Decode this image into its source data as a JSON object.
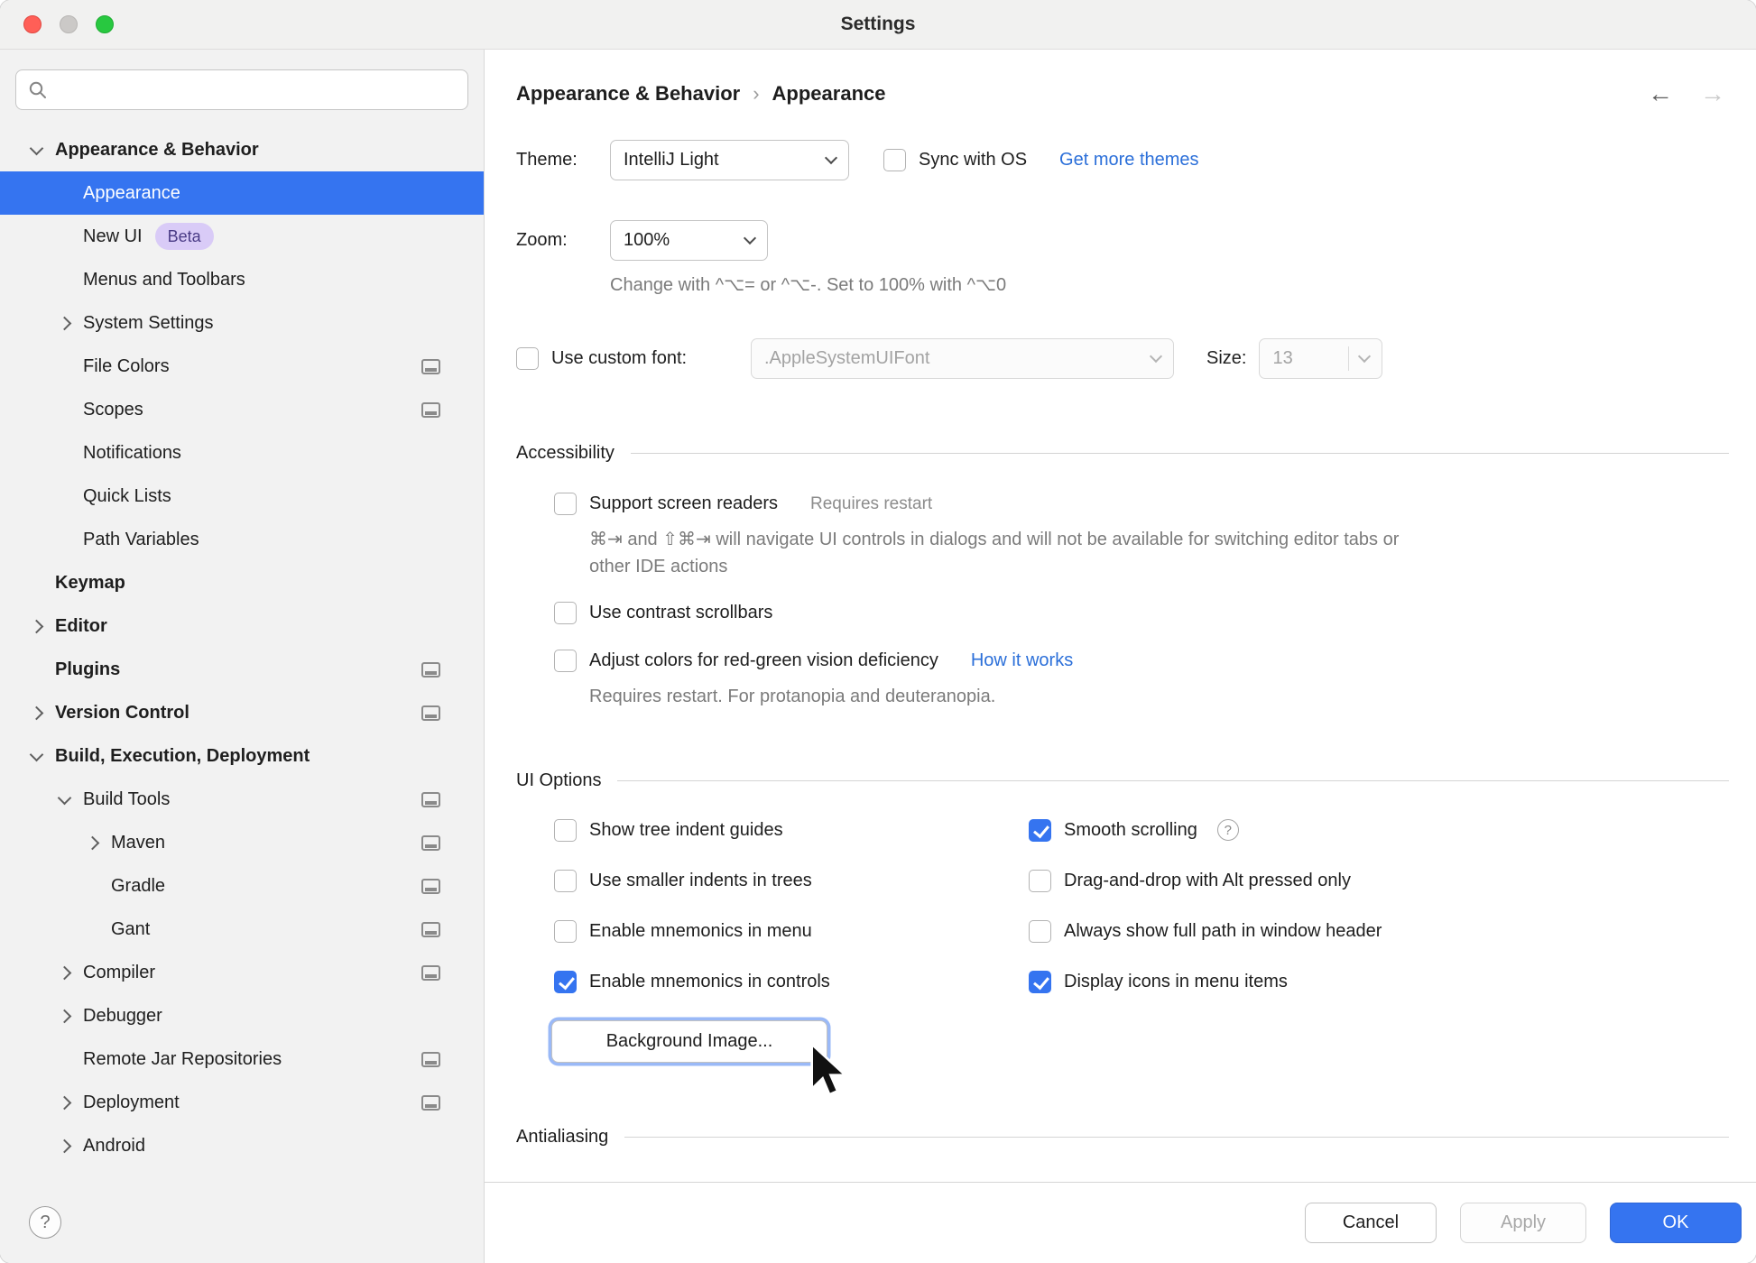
{
  "window": {
    "title": "Settings"
  },
  "icons": {
    "search": "magnifier",
    "back": "←",
    "forward": "→",
    "help": "?"
  },
  "colors": {
    "accent": "#3574F0",
    "link": "#2B6FD9",
    "selection_bg": "#3574F0"
  },
  "sidebar": {
    "search": {
      "placeholder": "",
      "value": ""
    },
    "items": [
      {
        "label": "Appearance & Behavior",
        "level": 0,
        "bold": true,
        "chevron": "down"
      },
      {
        "label": "Appearance",
        "level": 1,
        "selected": true
      },
      {
        "label": "New UI",
        "level": 1,
        "badge": "Beta"
      },
      {
        "label": "Menus and Toolbars",
        "level": 1
      },
      {
        "label": "System Settings",
        "level": 1,
        "chevron": "right"
      },
      {
        "label": "File Colors",
        "level": 1,
        "trailing_icon": true
      },
      {
        "label": "Scopes",
        "level": 1,
        "trailing_icon": true
      },
      {
        "label": "Notifications",
        "level": 1
      },
      {
        "label": "Quick Lists",
        "level": 1
      },
      {
        "label": "Path Variables",
        "level": 1
      },
      {
        "label": "Keymap",
        "level": 0,
        "bold": true
      },
      {
        "label": "Editor",
        "level": 0,
        "bold": true,
        "chevron": "right"
      },
      {
        "label": "Plugins",
        "level": 0,
        "bold": true,
        "trailing_icon": true
      },
      {
        "label": "Version Control",
        "level": 0,
        "bold": true,
        "chevron": "right",
        "trailing_icon": true
      },
      {
        "label": "Build, Execution, Deployment",
        "level": 0,
        "bold": true,
        "chevron": "down"
      },
      {
        "label": "Build Tools",
        "level": 1,
        "chevron": "down",
        "trailing_icon": true
      },
      {
        "label": "Maven",
        "level": 2,
        "chevron": "right",
        "trailing_icon": true
      },
      {
        "label": "Gradle",
        "level": 2,
        "trailing_icon": true
      },
      {
        "label": "Gant",
        "level": 2,
        "trailing_icon": true
      },
      {
        "label": "Compiler",
        "level": 1,
        "chevron": "right",
        "trailing_icon": true
      },
      {
        "label": "Debugger",
        "level": 1,
        "chevron": "right"
      },
      {
        "label": "Remote Jar Repositories",
        "level": 1,
        "trailing_icon": true
      },
      {
        "label": "Deployment",
        "level": 1,
        "chevron": "right",
        "trailing_icon": true
      },
      {
        "label": "Android",
        "level": 1,
        "chevron": "right"
      }
    ]
  },
  "breadcrumb": {
    "parent": "Appearance & Behavior",
    "separator": "›",
    "current": "Appearance"
  },
  "theme": {
    "label": "Theme:",
    "value": "IntelliJ Light",
    "sync_label": "Sync with OS",
    "sync_checked": false,
    "link": "Get more themes"
  },
  "zoom": {
    "label": "Zoom:",
    "value": "100%",
    "hint": "Change with ^⌥= or ^⌥-. Set to 100% with ^⌥0"
  },
  "custom_font": {
    "label": "Use custom font:",
    "checked": false,
    "font_value": ".AppleSystemUIFont",
    "size_label": "Size:",
    "size_value": "13"
  },
  "accessibility": {
    "title": "Accessibility",
    "screen_readers_label": "Support screen readers",
    "screen_readers_note": "Requires restart",
    "screen_readers_checked": false,
    "screen_readers_hint": "⌘⇥ and ⇧⌘⇥ will navigate UI controls in dialogs and will not be available for switching editor tabs or other IDE actions",
    "contrast_label": "Use contrast scrollbars",
    "contrast_checked": false,
    "redgreen_label": "Adjust colors for red-green vision deficiency",
    "redgreen_checked": false,
    "redgreen_link": "How it works",
    "redgreen_hint": "Requires restart. For protanopia and deuteranopia."
  },
  "ui_options": {
    "title": "UI Options",
    "left": [
      {
        "label": "Show tree indent guides",
        "checked": false
      },
      {
        "label": "Use smaller indents in trees",
        "checked": false
      },
      {
        "label": "Enable mnemonics in menu",
        "checked": false
      },
      {
        "label": "Enable mnemonics in controls",
        "checked": true
      }
    ],
    "right": [
      {
        "label": "Smooth scrolling",
        "checked": true,
        "help": true
      },
      {
        "label": "Drag-and-drop with Alt pressed only",
        "checked": false
      },
      {
        "label": "Always show full path in window header",
        "checked": false
      },
      {
        "label": "Display icons in menu items",
        "checked": true
      }
    ],
    "background_button": "Background Image..."
  },
  "antialiasing": {
    "title": "Antialiasing"
  },
  "footer": {
    "cancel": "Cancel",
    "apply": "Apply",
    "ok": "OK"
  }
}
